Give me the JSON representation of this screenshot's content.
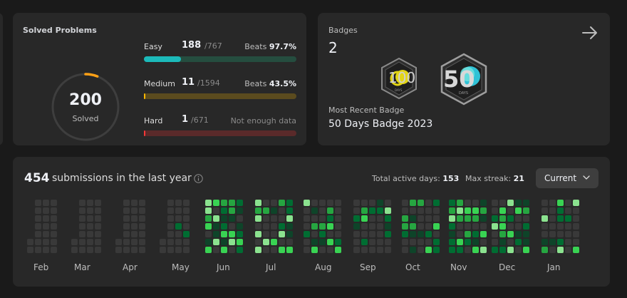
{
  "colors": {
    "easy": "#1cbaba",
    "easy_track": "#254d3f",
    "medium": "#ffb700",
    "medium_track": "#5b4b1e",
    "hard": "#f63737",
    "hard_track": "#5a2a2a",
    "heat_empty": "#393939",
    "heat_levels": [
      "#0e4429",
      "#006d32",
      "#26a641",
      "#39d353",
      "#8be28f"
    ]
  },
  "solved": {
    "title": "Solved Problems",
    "total": "200",
    "total_label": "Solved",
    "progress": 0.059,
    "difficulties": [
      {
        "name": "Easy",
        "solved": "188",
        "total": "/767",
        "beats_label": "Beats",
        "beats": "97.7%",
        "fraction": 0.245
      },
      {
        "name": "Medium",
        "solved": "11",
        "total": "/1594",
        "beats_label": "Beats",
        "beats": "43.5%",
        "fraction": 0.007
      },
      {
        "name": "Hard",
        "solved": "1",
        "total": "/671",
        "beats_label": "",
        "beats": "Not enough data",
        "fraction": 0.0015
      }
    ]
  },
  "badges": {
    "title": "Badges",
    "count": "2",
    "items": [
      {
        "icon": "100-days-badge-icon",
        "label": "100",
        "sub": "DAYS"
      },
      {
        "icon": "50-days-badge-icon",
        "label": "50",
        "sub": "DAYS"
      }
    ],
    "recent_label": "Most Recent Badge",
    "recent_name": "50 Days Badge 2023"
  },
  "submissions": {
    "count": "454",
    "label": "submissions in the last year",
    "active_days_label": "Total active days:",
    "active_days": "153",
    "max_streak_label": "Max streak:",
    "max_streak": "21",
    "dropdown": "Current",
    "months": [
      "Feb",
      "Mar",
      "Apr",
      "May",
      "Jun",
      "Jul",
      "Aug",
      "Sep",
      "Oct",
      "Nov",
      "Dec",
      "Jan"
    ]
  }
}
